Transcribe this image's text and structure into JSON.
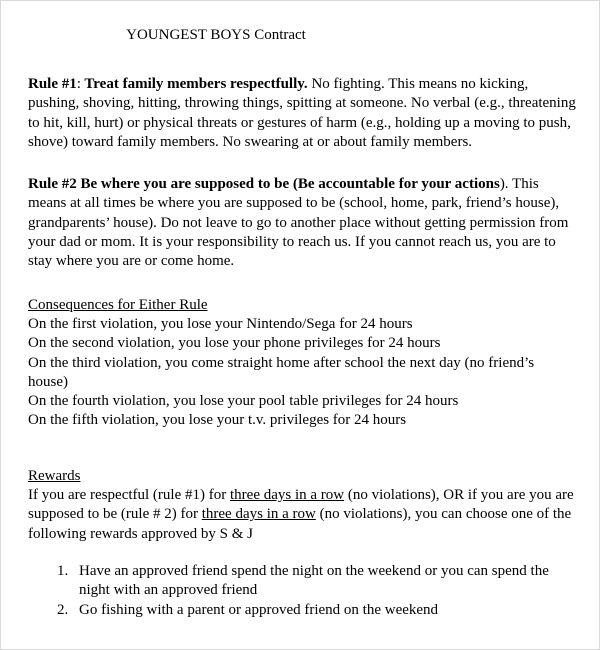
{
  "document": {
    "title": "YOUNGEST BOYS Contract",
    "rules": [
      {
        "label": "Rule #1",
        "separator": ":",
        "heading": " Treat family members respectfully.",
        "body": "  No fighting.  This means no kicking, pushing, shoving, hitting, throwing things, spitting at someone. No verbal (e.g., threatening to hit, kill, hurt) or physical threats or gestures of harm (e.g., holding up a moving to push, shove) toward family members. No swearing at or about family members."
      },
      {
        "label": "Rule #2",
        "separator": "",
        "heading": "  Be where you are supposed to be (Be accountable for your actions",
        "body": "). This means at all times be where you are supposed to be (school, home, park, friend’s house), grandparents’ house). Do not leave to go to another place without getting permission from your dad or mom. It is your responsibility to reach us. If you cannot reach us, you are to stay where you are or come home."
      }
    ],
    "consequences": {
      "heading": "Consequences for Either Rule",
      "items": [
        "On the first violation, you lose your Nintendo/Sega for 24 hours",
        "On the second violation, you lose your phone privileges for 24 hours",
        "On the third violation, you come straight home after school the next day (no friend’s house)",
        "On the fourth violation, you lose your pool table privileges for 24 hours",
        "On the fifth violation, you lose your t.v. privileges for 24 hours"
      ]
    },
    "rewards": {
      "heading": "Rewards",
      "paragraph_part1": "If you are respectful (rule #1) for ",
      "emphasis1": "three days in a row",
      "paragraph_part2": " (no violations), OR if you are you are supposed to be (rule # 2) for ",
      "emphasis2": "three days in a row",
      "paragraph_part3": " (no violations), you can choose one of the following rewards approved by S & J",
      "items": [
        "Have an approved friend spend the night on the weekend or you can spend the night with an approved friend",
        "Go fishing with a parent or approved friend on the weekend"
      ]
    }
  }
}
